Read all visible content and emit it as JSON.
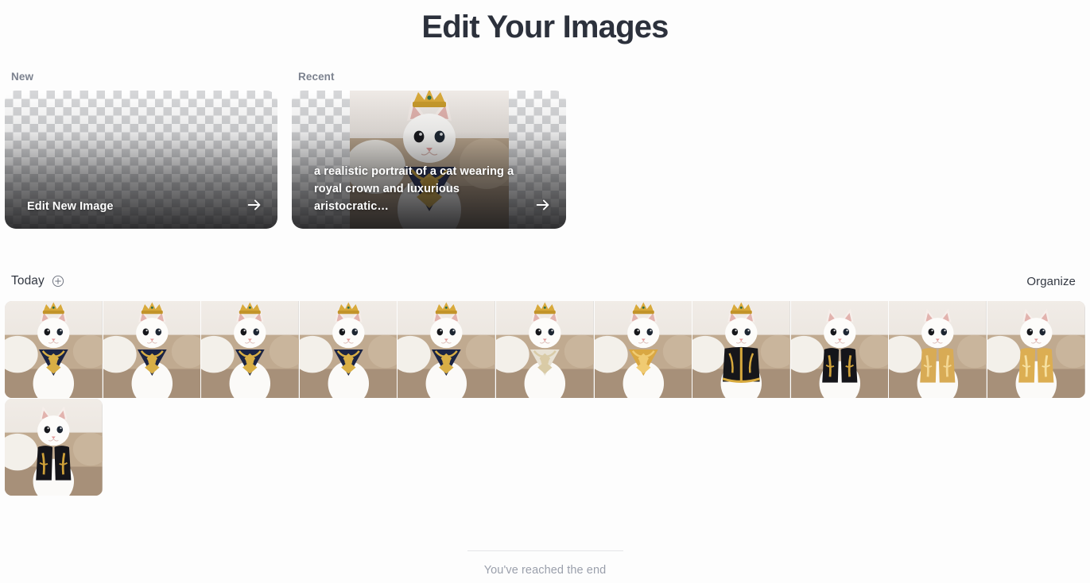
{
  "page": {
    "title": "Edit Your Images",
    "background_color": "#fdfdfd",
    "title_color": "#2c313c"
  },
  "new_card": {
    "label": "New",
    "action_label": "Edit New Image",
    "arrow_icon": "arrow-right-icon",
    "background": "transparency-checkerboard"
  },
  "recent_card": {
    "label": "Recent",
    "prompt_text": "a realistic portrait of a cat wearing a royal crown and luxurious aristocratic…",
    "arrow_icon": "arrow-right-icon",
    "background": "transparency-checkerboard"
  },
  "gallery": {
    "section_title": "Today",
    "add_icon": "plus-circle-icon",
    "organize_label": "Organize",
    "items": [
      {
        "alt": "white cat with gold crown and navy jeweled collar",
        "variant": "navy-collar",
        "crown": true
      },
      {
        "alt": "white cat with gold crown and navy jeweled collar",
        "variant": "navy-collar",
        "crown": true
      },
      {
        "alt": "white cat with gold crown and navy jeweled collar",
        "variant": "navy-collar",
        "crown": true
      },
      {
        "alt": "white cat with gold crown and navy jeweled collar",
        "variant": "navy-collar",
        "crown": true
      },
      {
        "alt": "white cat with gold crown and navy jeweled collar",
        "variant": "navy-collar",
        "crown": true
      },
      {
        "alt": "white cat with gold crown and diamond collar",
        "variant": "diamond-collar",
        "crown": true
      },
      {
        "alt": "white cat with gold crown and gold bib collar",
        "variant": "gold-bib",
        "crown": true
      },
      {
        "alt": "white cat with gold crown and black gold embroidered jacket",
        "variant": "black-gold-jacket",
        "crown": true
      },
      {
        "alt": "white cat in black and gold embroidered vest",
        "variant": "black-gold-vest",
        "crown": false
      },
      {
        "alt": "white cat in gold brocade vest",
        "variant": "gold-vest",
        "crown": false
      },
      {
        "alt": "white cat in gold sequin vest",
        "variant": "gold-sequin-vest",
        "crown": false
      },
      {
        "alt": "white cat in black and gold embroidered vest",
        "variant": "black-gold-vest",
        "crown": false
      }
    ]
  },
  "footer": {
    "end_text": "You've reached the end"
  }
}
